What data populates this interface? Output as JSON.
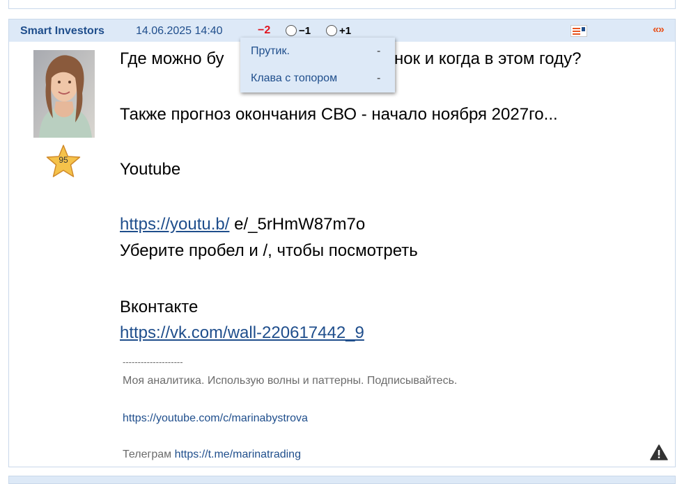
{
  "post": {
    "author": "Smart Investors",
    "timestamp": "14.06.2025 14:40",
    "rating": "−2",
    "vote_minus_label": "−1",
    "vote_plus_label": "+1",
    "quote_icon": "«»",
    "star_level": "95",
    "lines": {
      "l1_left": "Где можно бу",
      "l1_right": "нок и когда в этом году?",
      "l2": "Также прогноз окончания СВО - начало ноября 2027го...",
      "l3": "Youtube",
      "l4_link": "https://youtu.b/",
      "l4_rest": " e/_5rHmW87m7o",
      "l5": "Уберите пробел и /, чтобы посмотреть",
      "l6": "Вконтакте",
      "l7_link": "https://vk.com/wall-220617442_9"
    },
    "signature": {
      "divider": "--------------------",
      "text": "Моя аналитика. Использую волны и паттерны. Подписывайтесь.",
      "youtube_link": "https://youtube.com/c/marinabystrova",
      "telegram_label": "Телеграм ",
      "telegram_link": "https://t.me/marinatrading"
    }
  },
  "voters_dropdown": {
    "items": [
      {
        "name": "Прутик.",
        "mark": "-"
      },
      {
        "name": "Клава с топором",
        "mark": "-"
      }
    ]
  },
  "colors": {
    "header_bg": "#dde9f7",
    "link": "#1f4e8c",
    "rating_negative": "#e0141e",
    "quote_accent": "#e8541e"
  },
  "icons": [
    "message-icon",
    "quote-icon",
    "star-badge-icon",
    "warning-icon",
    "radio-circle-icon"
  ]
}
